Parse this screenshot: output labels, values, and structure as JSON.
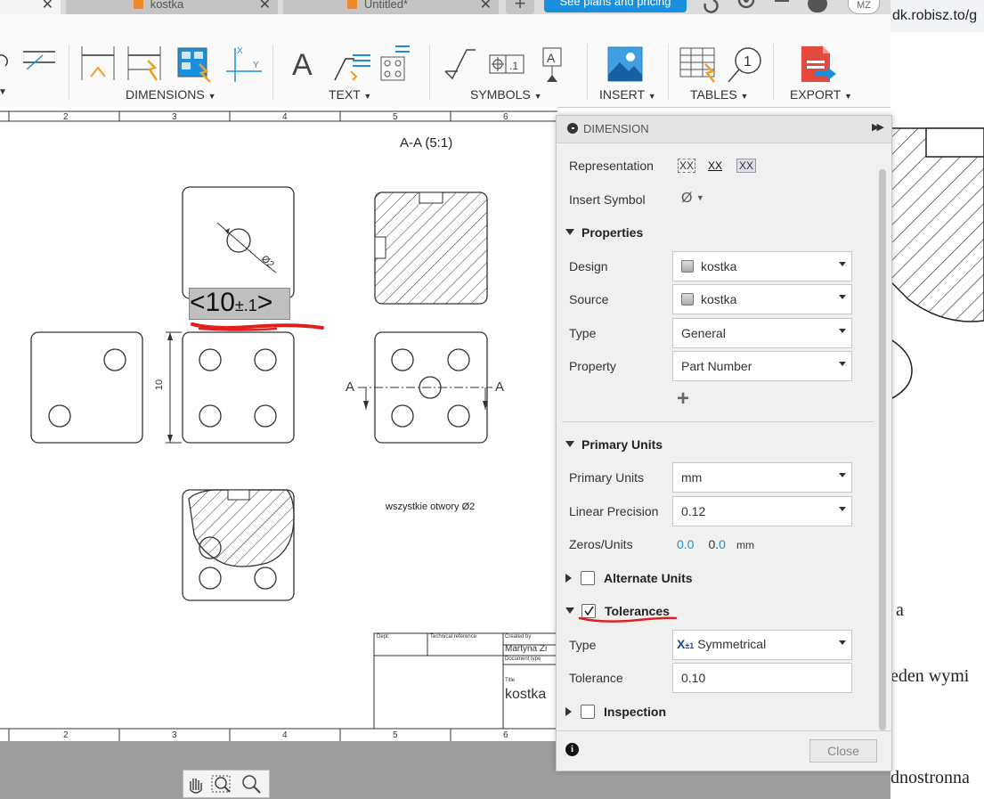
{
  "browser": {
    "tabs": [
      {
        "label": "kostka"
      },
      {
        "label": "Untitled*"
      }
    ],
    "plans_button": "See plans and pricing",
    "avatar": "MZ",
    "url_fragment": "dk.robisz.to/g",
    "page_text": [
      "a",
      "eden wymi",
      "dnostronna"
    ]
  },
  "toolbar": {
    "groups": [
      {
        "label": "DIMENSIONS"
      },
      {
        "label": "TEXT"
      },
      {
        "label": "SYMBOLS"
      },
      {
        "label": "INSERT"
      },
      {
        "label": "TABLES"
      },
      {
        "label": "EXPORT"
      }
    ],
    "text_tool_glyph": "A"
  },
  "drawing": {
    "ruler_numbers": [
      "2",
      "3",
      "4",
      "5",
      "6"
    ],
    "section_title": "A-A (5:1)",
    "dim_edit_text": "<10±.1>",
    "dim_edit_main": "<10",
    "dim_edit_tol": "±.1",
    "dim_edit_close": ">",
    "dim_vertical": "10",
    "dim_diameter": "Ø2",
    "section_marker": "A",
    "note": "wszystkie otwory Ø2",
    "title_block": {
      "dept": "Dept.",
      "tech_ref": "Technical reference",
      "created_by": "Created by",
      "creator": "Martyna Zi",
      "doc_type": "Document type",
      "title_label": "Title",
      "title": "kostka"
    }
  },
  "panel": {
    "header": "DIMENSION",
    "representation_label": "Representation",
    "representation_options": [
      "XX",
      "XX",
      "XX"
    ],
    "insert_symbol_label": "Insert Symbol",
    "insert_symbol_value": "Ø",
    "properties": {
      "title": "Properties",
      "design_label": "Design",
      "design_value": "kostka",
      "source_label": "Source",
      "source_value": "kostka",
      "type_label": "Type",
      "type_value": "General",
      "property_label": "Property",
      "property_value": "Part Number",
      "add": "+"
    },
    "primary_units": {
      "title": "Primary Units",
      "units_label": "Primary Units",
      "units_value": "mm",
      "precision_label": "Linear Precision",
      "precision_value": "0.12",
      "zeros_label": "Zeros/Units",
      "zero1": "0.0",
      "zero2": "0.0",
      "zero_unit": "mm"
    },
    "alternate_units": {
      "title": "Alternate Units",
      "checked": false
    },
    "tolerances": {
      "title": "Tolerances",
      "checked": true,
      "type_label": "Type",
      "type_value": "Symmetrical",
      "type_icon": "X±1",
      "tolerance_label": "Tolerance",
      "tolerance_value": "0.10"
    },
    "inspection": {
      "title": "Inspection",
      "checked": false
    },
    "close_button": "Close"
  },
  "colors": {
    "accent_blue": "#1a8fde",
    "annotation_red": "#e0201e",
    "hatch": "#333333"
  }
}
